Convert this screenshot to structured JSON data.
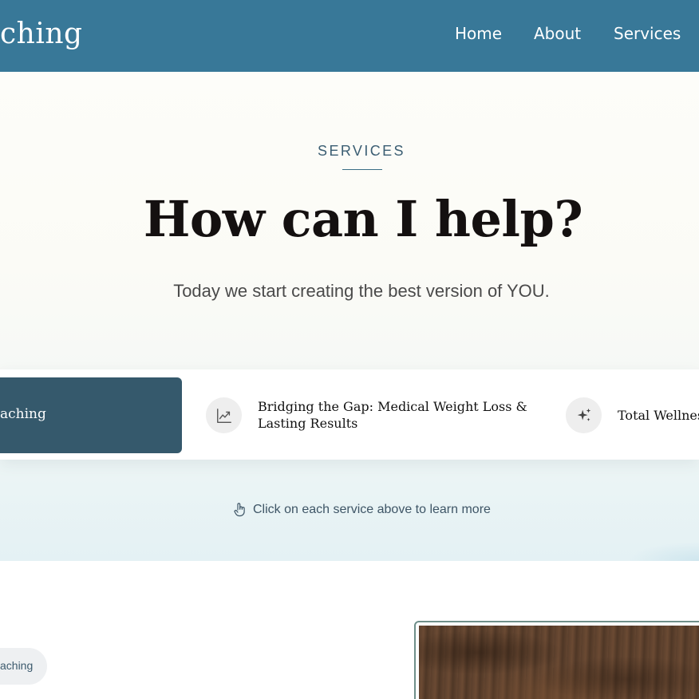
{
  "header": {
    "brand": "ching",
    "nav": [
      {
        "label": "Home"
      },
      {
        "label": "About"
      },
      {
        "label": "Services"
      }
    ]
  },
  "hero": {
    "eyebrow": "SERVICES",
    "title": "How can I help?",
    "subtitle": "Today we start creating the best version of YOU."
  },
  "services": {
    "items": [
      {
        "label": "aching",
        "icon": "none",
        "active": true
      },
      {
        "label_line1": "Bridging the Gap: Medical Weight Loss &",
        "label_line2": "Lasting Results",
        "icon": "trend-line-icon"
      },
      {
        "label": "Total Wellnes",
        "icon": "sparkle-icon"
      }
    ]
  },
  "hint": {
    "icon": "pointer-hand-icon",
    "text": "Click on each service above to learn more"
  },
  "lower": {
    "pill_label": "aching"
  },
  "colors": {
    "header_bg": "#387898",
    "active_service_bg": "#35596c",
    "title_text": "#141010",
    "eyebrow_text": "#3b5e73"
  }
}
